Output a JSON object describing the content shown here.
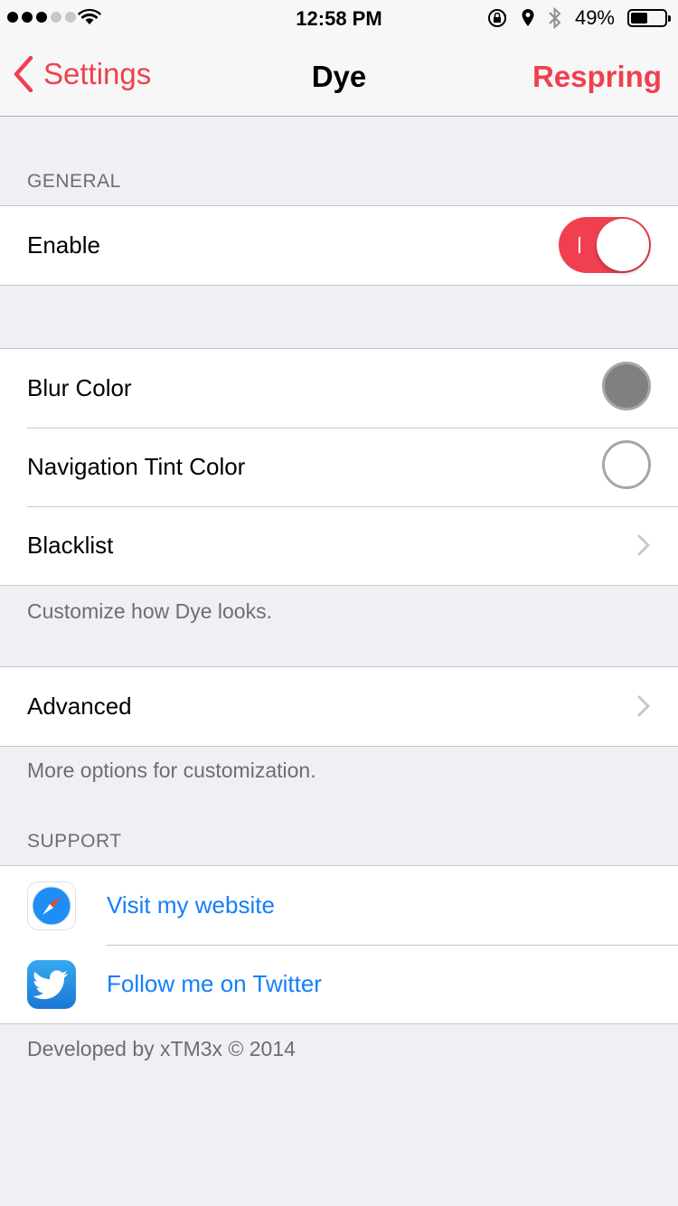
{
  "status_bar": {
    "time": "12:58 PM",
    "battery_percent": "49%",
    "battery_level": 0.49,
    "signal_bars_filled": 3,
    "signal_bars_total": 5
  },
  "nav": {
    "back_label": "Settings",
    "title": "Dye",
    "right_button": "Respring"
  },
  "general": {
    "header": "GENERAL",
    "enable_label": "Enable",
    "enable_on": true
  },
  "appearance": {
    "blur_color_label": "Blur Color",
    "blur_color_value": "#808080",
    "nav_tint_label": "Navigation Tint Color",
    "nav_tint_value": "#ffffff",
    "blacklist_label": "Blacklist",
    "footer": "Customize how Dye looks."
  },
  "advanced": {
    "label": "Advanced",
    "footer": "More options for customization."
  },
  "support": {
    "header": "SUPPORT",
    "website_label": "Visit my website",
    "twitter_label": "Follow me on Twitter",
    "footer": "Developed by xTM3x © 2014"
  },
  "colors": {
    "accent": "#f0404f",
    "link": "#147efb",
    "background": "#efeff4"
  }
}
